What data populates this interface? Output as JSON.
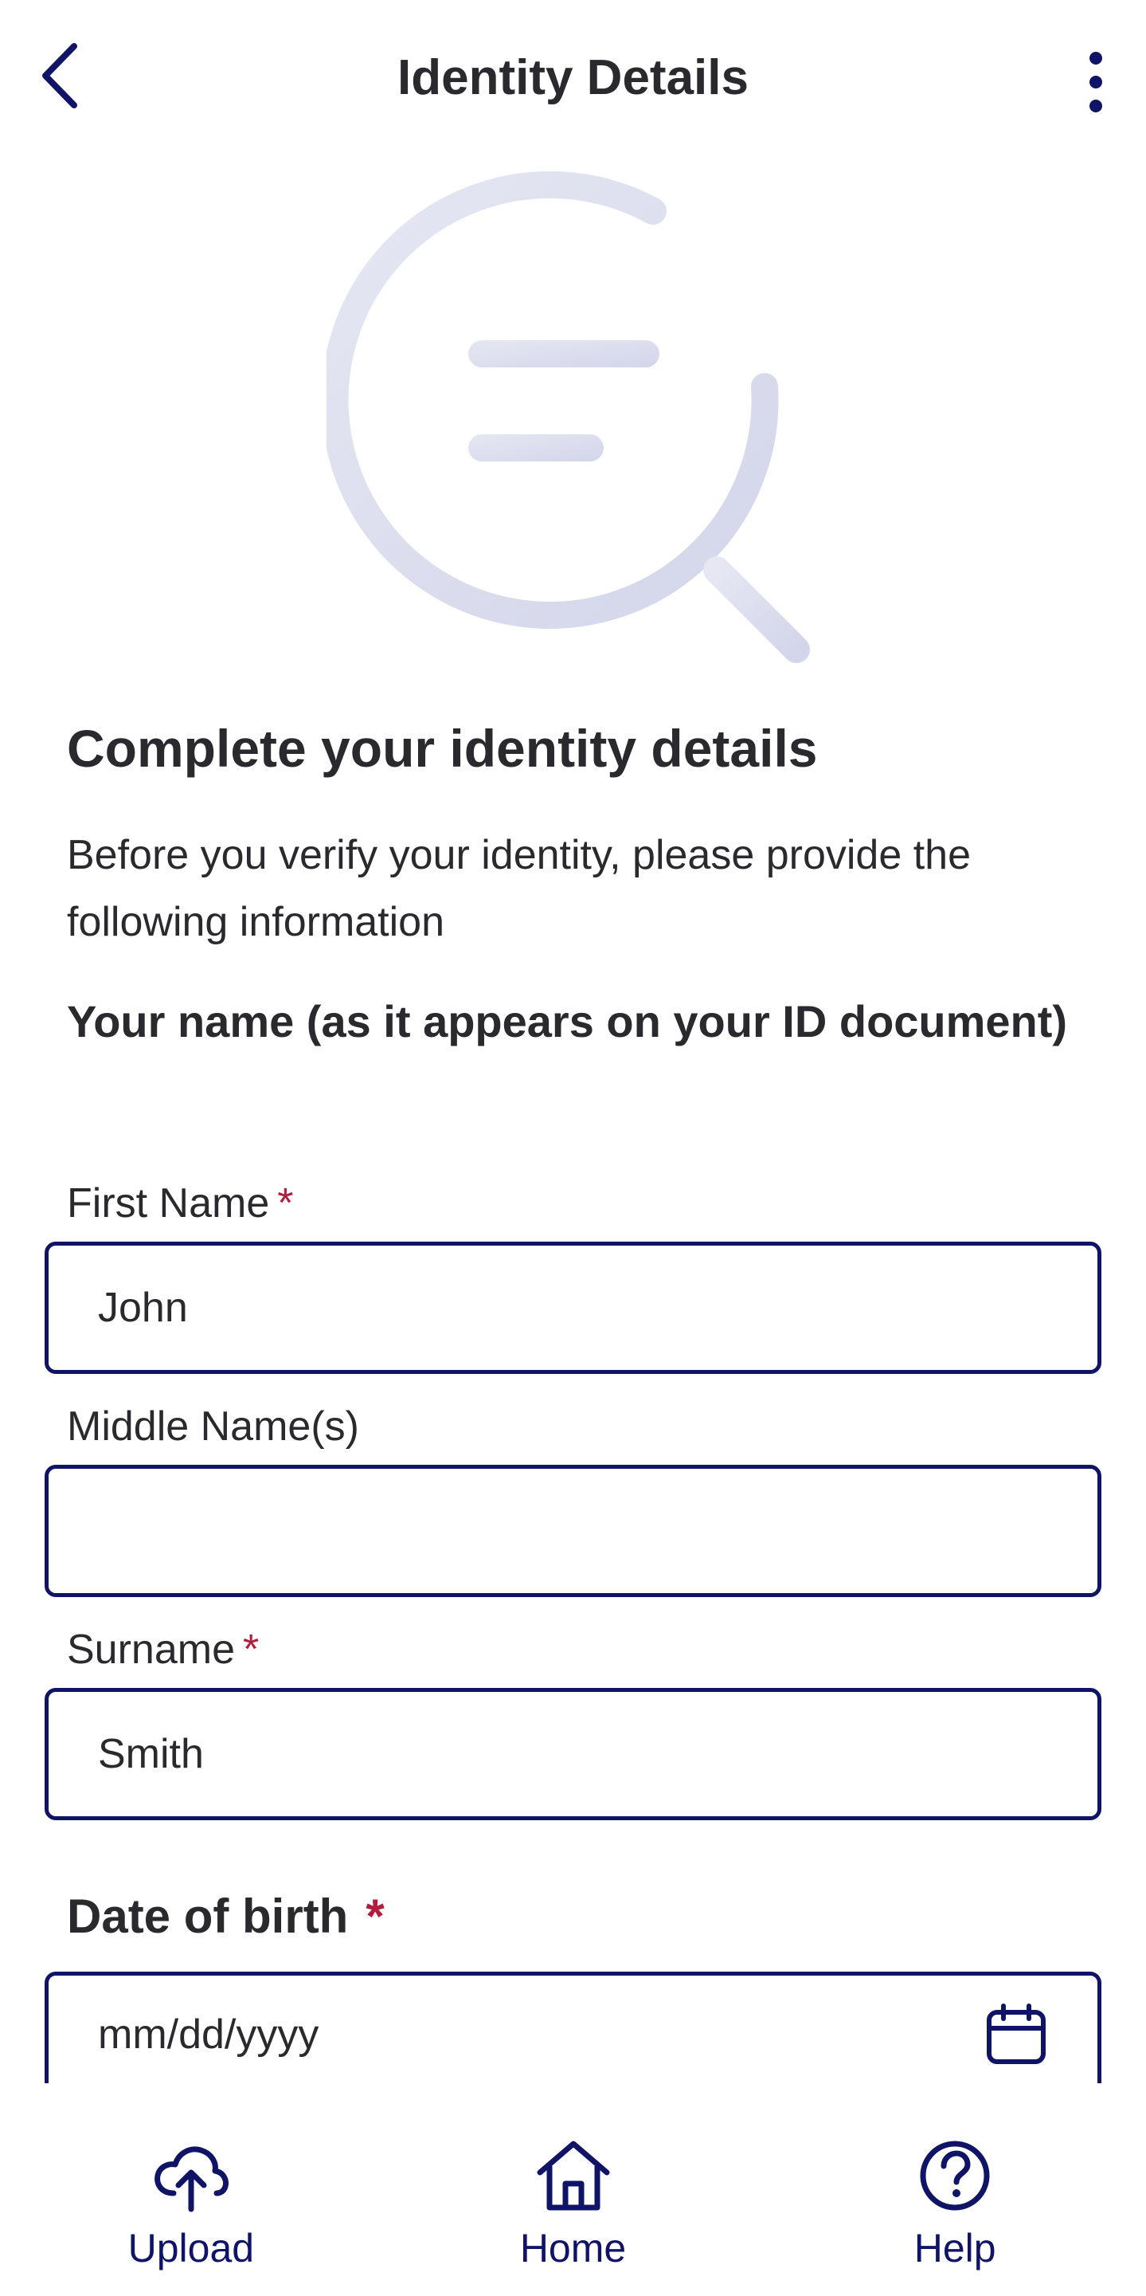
{
  "colors": {
    "brand_navy": "#0f1466",
    "text": "#2a2a2e",
    "required_red": "#b01e3c",
    "hero_light": "#dfe0f0"
  },
  "header": {
    "title": "Identity Details",
    "back_icon": "chevron-left-icon",
    "menu_icon": "more-vertical-icon"
  },
  "hero": {
    "icon": "document-search-icon"
  },
  "main": {
    "title": "Complete your identity details",
    "intro": "Before you verify your identity, please provide the following information",
    "name_section_title": "Your name (as it appears on your ID document)"
  },
  "form": {
    "required_marker": "*",
    "first_name": {
      "label": "First Name",
      "value": "John"
    },
    "middle_name": {
      "label": "Middle Name(s)",
      "value": ""
    },
    "surname": {
      "label": "Surname",
      "value": "Smith"
    },
    "dob": {
      "label": "Date of birth",
      "placeholder": "mm/dd/yyyy",
      "icon": "calendar-icon"
    }
  },
  "bottom_nav": [
    {
      "label": "Upload",
      "icon": "upload-cloud-icon"
    },
    {
      "label": "Home",
      "icon": "home-icon"
    },
    {
      "label": "Help",
      "icon": "help-circle-icon"
    }
  ]
}
